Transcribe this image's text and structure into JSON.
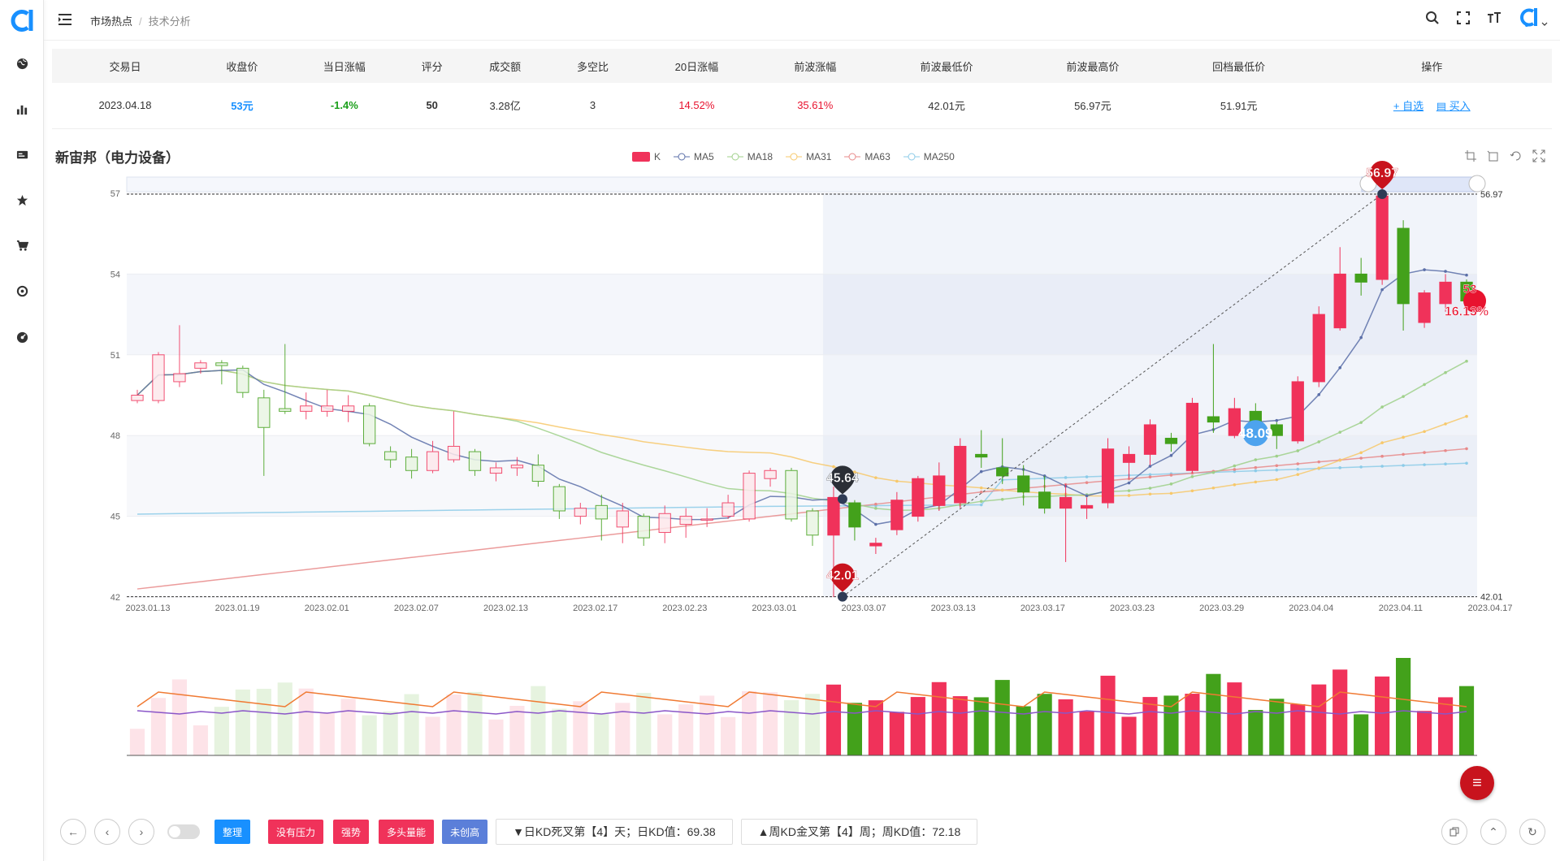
{
  "topbar": {
    "breadcrumb": [
      "市场热点",
      "技术分析"
    ]
  },
  "table": {
    "headers": [
      "交易日",
      "收盘价",
      "当日涨幅",
      "评分",
      "成交额",
      "多空比",
      "20日涨幅",
      "前波涨幅",
      "前波最低价",
      "前波最高价",
      "回档最低价",
      "操作"
    ],
    "row": [
      "2023.04.18",
      "53元",
      "-1.4%",
      "50",
      "3.28亿",
      "3",
      "14.52%",
      "35.61%",
      "42.01元",
      "56.97元",
      "51.91元"
    ],
    "actions": [
      "+ 自选",
      "买入"
    ]
  },
  "stock_name": "新宙邦（电力设备）",
  "legend": [
    {
      "name": "K",
      "color": "#f0325a"
    },
    {
      "name": "MA5",
      "color": "#5b6fa8"
    },
    {
      "name": "MA18",
      "color": "#9fd08a"
    },
    {
      "name": "MA31",
      "color": "#f7c86a"
    },
    {
      "name": "MA63",
      "color": "#e88a8a"
    },
    {
      "name": "MA250",
      "color": "#8ccbe8"
    }
  ],
  "colors": {
    "up": "#f0325a",
    "down": "#43a11b",
    "blue": "#1890ff",
    "fab": "#c8131d"
  },
  "chart_data": {
    "type": "candlestick",
    "title": "新宙邦（电力设备）",
    "ylim": [
      42,
      57
    ],
    "yticks": [
      "57",
      "54",
      "51",
      "48",
      "45",
      "42"
    ],
    "x_labels": [
      "2023.01.13",
      "2023.01.19",
      "2023.02.01",
      "2023.02.07",
      "2023.02.13",
      "2023.02.17",
      "2023.02.23",
      "2023.03.01",
      "2023.03.07",
      "2023.03.13",
      "2023.03.17",
      "2023.03.23",
      "2023.03.29",
      "2023.04.04",
      "2023.04.11",
      "2023.04.17"
    ],
    "markers": [
      {
        "label": "56.97",
        "price": 56.97
      },
      {
        "label": "42.01",
        "price": 42.01
      },
      {
        "label": "45.64",
        "price": 45.64
      },
      {
        "label": "48.09",
        "price": 48.09
      },
      {
        "label": "53",
        "price": 53
      },
      {
        "label": "16.13%",
        "price": 53
      }
    ],
    "price_lines": [
      "56.97",
      "42.01"
    ],
    "candles": [
      {
        "o": 49.3,
        "c": 49.5,
        "h": 49.7,
        "l": 49.2
      },
      {
        "o": 49.3,
        "c": 51.0,
        "h": 51.1,
        "l": 49.2
      },
      {
        "o": 50.0,
        "c": 50.3,
        "h": 52.1,
        "l": 49.8
      },
      {
        "o": 50.5,
        "c": 50.7,
        "h": 50.8,
        "l": 50.3
      },
      {
        "o": 50.7,
        "c": 50.6,
        "h": 50.8,
        "l": 49.9
      },
      {
        "o": 50.5,
        "c": 49.6,
        "h": 50.6,
        "l": 49.4
      },
      {
        "o": 49.4,
        "c": 48.3,
        "h": 49.7,
        "l": 46.5
      },
      {
        "o": 49.0,
        "c": 48.9,
        "h": 51.4,
        "l": 48.8
      },
      {
        "o": 48.9,
        "c": 49.1,
        "h": 49.6,
        "l": 48.6
      },
      {
        "o": 48.9,
        "c": 49.1,
        "h": 49.7,
        "l": 48.7
      },
      {
        "o": 48.9,
        "c": 49.1,
        "h": 49.5,
        "l": 48.5
      },
      {
        "o": 49.1,
        "c": 47.7,
        "h": 49.2,
        "l": 47.6
      },
      {
        "o": 47.4,
        "c": 47.1,
        "h": 47.6,
        "l": 46.8
      },
      {
        "o": 47.2,
        "c": 46.7,
        "h": 47.5,
        "l": 46.4
      },
      {
        "o": 46.7,
        "c": 47.4,
        "h": 47.8,
        "l": 46.6
      },
      {
        "o": 47.1,
        "c": 47.6,
        "h": 48.9,
        "l": 47.0
      },
      {
        "o": 47.4,
        "c": 46.7,
        "h": 47.5,
        "l": 46.5
      },
      {
        "o": 46.6,
        "c": 46.8,
        "h": 47.0,
        "l": 46.3
      },
      {
        "o": 46.8,
        "c": 46.9,
        "h": 47.2,
        "l": 46.5
      },
      {
        "o": 46.9,
        "c": 46.3,
        "h": 47.3,
        "l": 46.1
      },
      {
        "o": 46.1,
        "c": 45.2,
        "h": 46.2,
        "l": 44.9
      },
      {
        "o": 45.0,
        "c": 45.3,
        "h": 45.5,
        "l": 44.7
      },
      {
        "o": 45.4,
        "c": 44.9,
        "h": 45.8,
        "l": 44.1
      },
      {
        "o": 44.6,
        "c": 45.2,
        "h": 45.5,
        "l": 44.0
      },
      {
        "o": 45.0,
        "c": 44.2,
        "h": 45.1,
        "l": 43.9
      },
      {
        "o": 44.4,
        "c": 45.1,
        "h": 45.4,
        "l": 44.0
      },
      {
        "o": 44.7,
        "c": 45.0,
        "h": 45.3,
        "l": 44.2
      },
      {
        "o": 44.9,
        "c": 44.9,
        "h": 45.3,
        "l": 44.6
      },
      {
        "o": 45.0,
        "c": 45.5,
        "h": 45.8,
        "l": 44.9
      },
      {
        "o": 44.9,
        "c": 46.6,
        "h": 46.7,
        "l": 44.8
      },
      {
        "o": 46.4,
        "c": 46.7,
        "h": 46.8,
        "l": 46.1
      },
      {
        "o": 46.7,
        "c": 44.9,
        "h": 46.8,
        "l": 44.8
      },
      {
        "o": 45.2,
        "c": 44.3,
        "h": 45.3,
        "l": 43.9
      },
      {
        "o": 44.3,
        "c": 45.7,
        "h": 46.1,
        "l": 42.0
      },
      {
        "o": 45.5,
        "c": 44.6,
        "h": 45.6,
        "l": 44.1
      },
      {
        "o": 43.9,
        "c": 44.0,
        "h": 44.2,
        "l": 43.6
      },
      {
        "o": 44.5,
        "c": 45.6,
        "h": 45.9,
        "l": 44.3
      },
      {
        "o": 45.0,
        "c": 46.4,
        "h": 46.5,
        "l": 44.8
      },
      {
        "o": 45.4,
        "c": 46.5,
        "h": 47.0,
        "l": 45.2
      },
      {
        "o": 45.5,
        "c": 47.6,
        "h": 47.9,
        "l": 45.3
      },
      {
        "o": 47.3,
        "c": 47.2,
        "h": 48.2,
        "l": 46.8
      },
      {
        "o": 46.8,
        "c": 46.5,
        "h": 47.9,
        "l": 46.2
      },
      {
        "o": 46.5,
        "c": 45.9,
        "h": 46.9,
        "l": 45.4
      },
      {
        "o": 45.9,
        "c": 45.3,
        "h": 46.5,
        "l": 45.1
      },
      {
        "o": 45.3,
        "c": 45.7,
        "h": 46.2,
        "l": 43.3
      },
      {
        "o": 45.3,
        "c": 45.4,
        "h": 45.7,
        "l": 44.9
      },
      {
        "o": 45.5,
        "c": 47.5,
        "h": 47.9,
        "l": 45.3
      },
      {
        "o": 47.0,
        "c": 47.3,
        "h": 47.6,
        "l": 46.4
      },
      {
        "o": 47.3,
        "c": 48.4,
        "h": 48.6,
        "l": 46.9
      },
      {
        "o": 47.9,
        "c": 47.7,
        "h": 48.1,
        "l": 47.4
      },
      {
        "o": 46.7,
        "c": 49.2,
        "h": 49.4,
        "l": 46.6
      },
      {
        "o": 48.7,
        "c": 48.5,
        "h": 51.4,
        "l": 48.1
      },
      {
        "o": 48.0,
        "c": 49.0,
        "h": 49.4,
        "l": 47.9
      },
      {
        "o": 48.9,
        "c": 48.1,
        "h": 49.2,
        "l": 48.0
      },
      {
        "o": 48.4,
        "c": 48.0,
        "h": 48.5,
        "l": 47.5
      },
      {
        "o": 47.8,
        "c": 50.0,
        "h": 50.2,
        "l": 47.7
      },
      {
        "o": 50.0,
        "c": 52.5,
        "h": 52.8,
        "l": 49.8
      },
      {
        "o": 52.0,
        "c": 54.0,
        "h": 55.0,
        "l": 51.9
      },
      {
        "o": 54.0,
        "c": 53.7,
        "h": 54.6,
        "l": 53.2
      },
      {
        "o": 53.8,
        "c": 56.9,
        "h": 56.97,
        "l": 53.6
      },
      {
        "o": 55.7,
        "c": 52.9,
        "h": 56.0,
        "l": 51.9
      },
      {
        "o": 52.2,
        "c": 53.3,
        "h": 53.4,
        "l": 52.0
      },
      {
        "o": 52.9,
        "c": 53.7,
        "h": 54.0,
        "l": 52.6
      },
      {
        "o": 53.7,
        "c": 53.0,
        "h": 53.8,
        "l": 52.6
      }
    ]
  },
  "bottom": {
    "tags": [
      {
        "label": "整理",
        "color": "#1890ff"
      },
      {
        "label": "没有压力",
        "color": "#f0325a"
      },
      {
        "label": "强势",
        "color": "#f0325a"
      },
      {
        "label": "多头量能",
        "color": "#f0325a"
      },
      {
        "label": "未创高",
        "color": "#5b7fd9"
      }
    ],
    "kd_day": "▼日KD死叉第【4】天；日KD值：69.38",
    "kd_week": "▲周KD金叉第【4】周；周KD值：72.18"
  }
}
